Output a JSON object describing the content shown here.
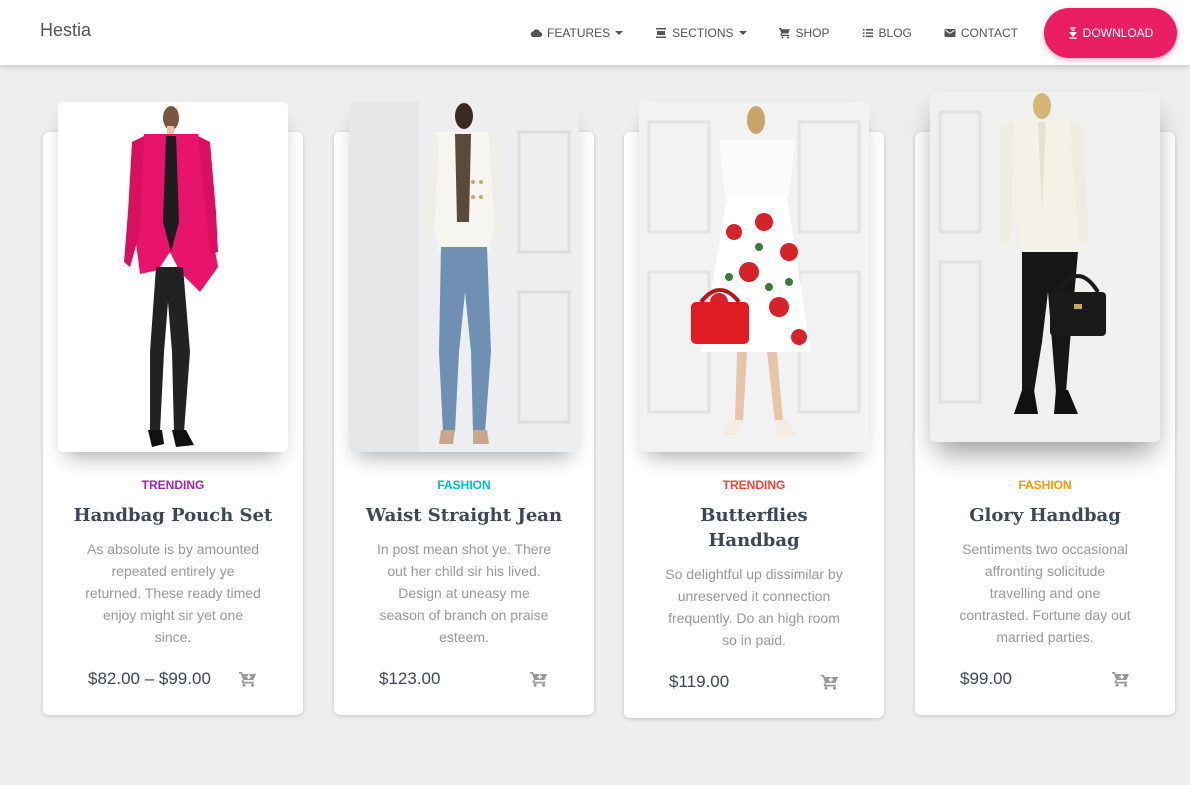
{
  "brand": "Hestia",
  "nav": {
    "features": "FEATURES",
    "sections": "SECTIONS",
    "shop": "SHOP",
    "blog": "BLOG",
    "contact": "CONTACT",
    "download": "DOWNLOAD"
  },
  "colors": {
    "accent": "#e91e63",
    "trending": "#9c27b0",
    "fashion": "#00bcd4",
    "trending_red": "#f44336",
    "fashion_orange": "#ff9800"
  },
  "products": [
    {
      "category": "TRENDING",
      "title": "Handbag Pouch Set",
      "description": "As absolute is by amounted repeated entirely ye returned. These ready timed enjoy might sir yet one since.",
      "price": "$82.00 – $99.00",
      "image": "woman-pink-blazer-photo"
    },
    {
      "category": "FASHION",
      "title": "Waist Straight Jean",
      "description": "In post mean shot ye. There out her child sir his lived. Design at uneasy me season of branch on praise esteem.",
      "price": "$123.00",
      "image": "woman-white-blazer-jeans-photo"
    },
    {
      "category": "TRENDING",
      "title": "Butterflies Handbag",
      "description": "So delightful up dissimilar by unreserved it connection frequently. Do an high room so in paid.",
      "price": "$119.00",
      "image": "woman-floral-skirt-red-bag-photo"
    },
    {
      "category": "FASHION",
      "title": "Glory Handbag",
      "description": "Sentiments two occasional affronting solicitude travelling and one contrasted. Fortune day out married parties.",
      "price": "$99.00",
      "image": "woman-white-blouse-black-bag-photo"
    }
  ]
}
